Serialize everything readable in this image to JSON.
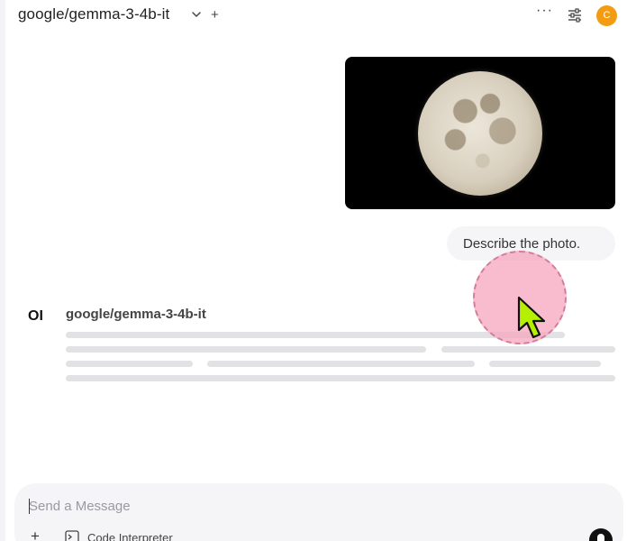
{
  "header": {
    "model_name": "google/gemma-3-4b-it",
    "new_chat_icon": "+",
    "more_icon": "···",
    "avatar_initial": "C",
    "avatar_color": "#f39c12"
  },
  "conversation": {
    "user_image": {
      "subject": "moon-photo"
    },
    "user_message": "Describe the photo.",
    "assistant": {
      "logo_text": "OI",
      "name": "google/gemma-3-4b-it",
      "state": "loading"
    }
  },
  "composer": {
    "placeholder": "Send a Message",
    "value": "",
    "add_icon": "+",
    "code_interpreter_label": "Code Interpreter"
  },
  "colors": {
    "bubble_bg": "#f5f4f7",
    "skeleton": "#e2e2e5",
    "click_indicator": "#f6a6be",
    "cursor_fill": "#b6f000"
  }
}
